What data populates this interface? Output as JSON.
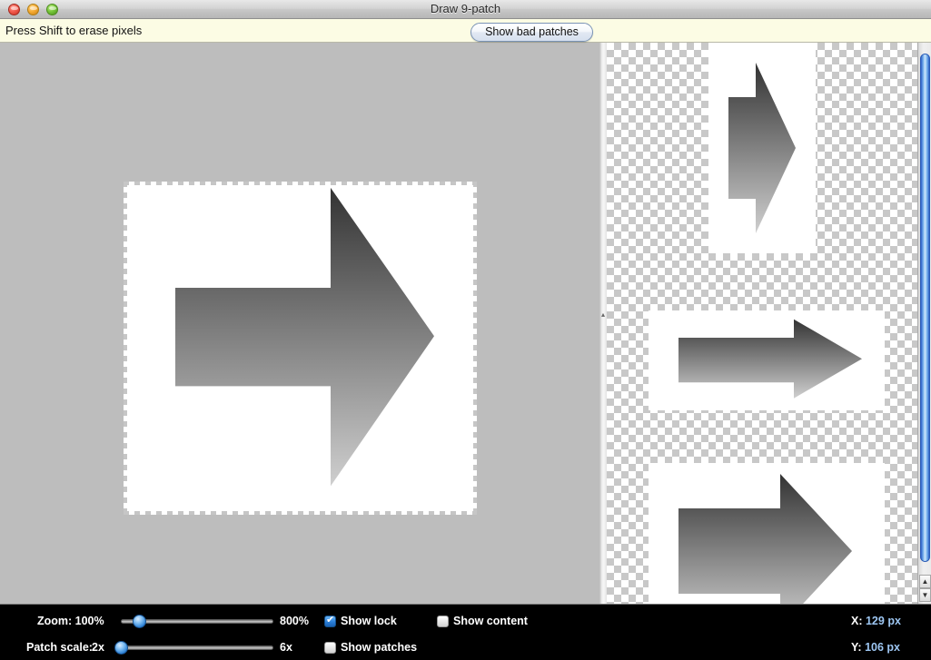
{
  "window": {
    "title": "Draw 9-patch",
    "controls": [
      {
        "name": "close",
        "glyph": ""
      },
      {
        "name": "minimize",
        "glyph": ""
      },
      {
        "name": "zoom",
        "glyph": ""
      }
    ]
  },
  "hintbar": {
    "message": "Press Shift to erase pixels",
    "show_bad_patches_label": "Show bad patches"
  },
  "canvas": {
    "image_background": "#ffffff",
    "pane_background": "#bdbdbd",
    "guide_color": "#c6c6c6",
    "arrow_gradient_from": "#3a3a3a",
    "arrow_gradient_to": "#c9c9c9"
  },
  "splitter": {
    "grip_glyph": "▴"
  },
  "preview": {
    "checker_color": "#c8c8c8",
    "items": [
      {
        "name": "preview-narrow-tall"
      },
      {
        "name": "preview-wide-short"
      },
      {
        "name": "preview-large"
      }
    ]
  },
  "scrollbar": {
    "up_glyph": "▲",
    "down_glyph": "▼",
    "thumb_color": "#79b3ee"
  },
  "bottombar": {
    "zoom": {
      "label": "Zoom: 100%",
      "min_label": "100%",
      "max_label": "800%",
      "value_percent": 12
    },
    "patch_scale": {
      "label": "Patch scale:",
      "min_label": "2x",
      "max_label": "6x",
      "value_percent": 0
    },
    "checkboxes": [
      {
        "label": "Show lock",
        "checked": true
      },
      {
        "label": "Show content",
        "checked": false
      },
      {
        "label": "Show patches",
        "checked": false
      }
    ],
    "coords": {
      "x_label": "X:",
      "x_value": "129 px",
      "y_label": "Y:",
      "y_value": "106 px"
    }
  }
}
